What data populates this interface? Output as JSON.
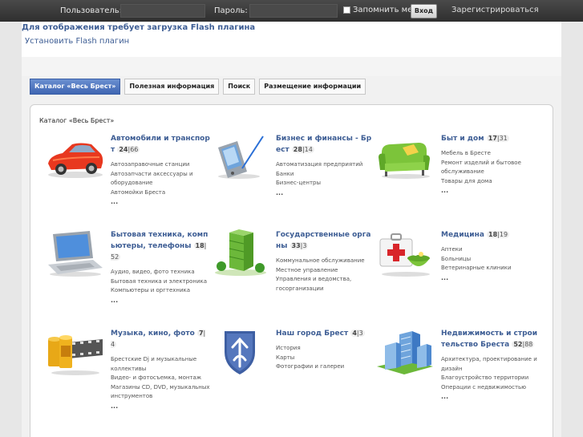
{
  "header": {
    "user_label": "Пользователь:",
    "password_label": "Пароль:",
    "remember_label": "Запомнить меня",
    "login_button": "Вход",
    "register_link": "Зарегистрироваться"
  },
  "flash": {
    "message": "Для отображения требует загрузка Flash плагина",
    "install_link": "Установить Flash плагин"
  },
  "tabs": [
    {
      "label": "Каталог «Весь Брест»"
    },
    {
      "label": "Полезная информация"
    },
    {
      "label": "Поиск"
    },
    {
      "label": "Размещение информации"
    }
  ],
  "catalog": {
    "title": "Каталог «Весь Брест»",
    "more": "...",
    "categories": [
      {
        "title": "Автомобили и транспорт",
        "count_a": "24",
        "count_b": "66",
        "subs": [
          "Автозаправочные станции",
          "Автозапчасти аксессуары и оборудование",
          "Автомойки Бреста"
        ]
      },
      {
        "title": "Бизнес и финансы - Брест",
        "count_a": "28",
        "count_b": "14",
        "subs": [
          "Автоматизация предприятий",
          "Банки",
          "Бизнес-центры"
        ]
      },
      {
        "title": "Быт и дом",
        "count_a": "17",
        "count_b": "31",
        "subs": [
          "Мебель в Бресте",
          "Ремонт изделий и бытовое обслуживание",
          "Товары для дома"
        ]
      },
      {
        "title": "Бытовая техника, компьютеры, телефоны",
        "count_a": "18",
        "count_b": "52",
        "subs": [
          "Аудио, видео, фото техника",
          "Бытовая техника и электроника",
          "Компьютеры и оргтехника"
        ]
      },
      {
        "title": "Государственные органы",
        "count_a": "33",
        "count_b": "3",
        "subs": [
          "Коммунальное обслуживание",
          "Местное управление",
          "Управления и ведомства, госорганизации"
        ]
      },
      {
        "title": "Медицина",
        "count_a": "18",
        "count_b": "19",
        "subs": [
          "Аптеки",
          "Больницы",
          "Ветеринарные клиники"
        ]
      },
      {
        "title": "Музыка, кино, фото",
        "count_a": "7",
        "count_b": "4",
        "subs": [
          "Брестские Dj и музыкальные коллективы",
          "Видео- и фотосъемка, монтаж",
          "Магазины CD, DVD, музыкальных инструментов"
        ]
      },
      {
        "title": "Наш город Брест",
        "count_a": "4",
        "count_b": "3",
        "subs": [
          "История",
          "Карты",
          "Фотографии и галереи"
        ]
      },
      {
        "title": "Недвижимость и строительство Бреста",
        "count_a": "52",
        "count_b": "88",
        "subs": [
          "Архитектура, проектирование и дизайн",
          "Благоустройство территории",
          "Операции с недвижимостью"
        ]
      }
    ]
  },
  "colors": {
    "link": "#3d5d94",
    "tab_active": "#4a70b8",
    "topbar": "#3a3a3a"
  },
  "icons": [
    "car-icon",
    "pda-icon",
    "sofa-icon",
    "laptop-icon",
    "building-icon",
    "first-aid-icon",
    "film-icon",
    "coat-of-arms-icon",
    "city-buildings-icon"
  ]
}
